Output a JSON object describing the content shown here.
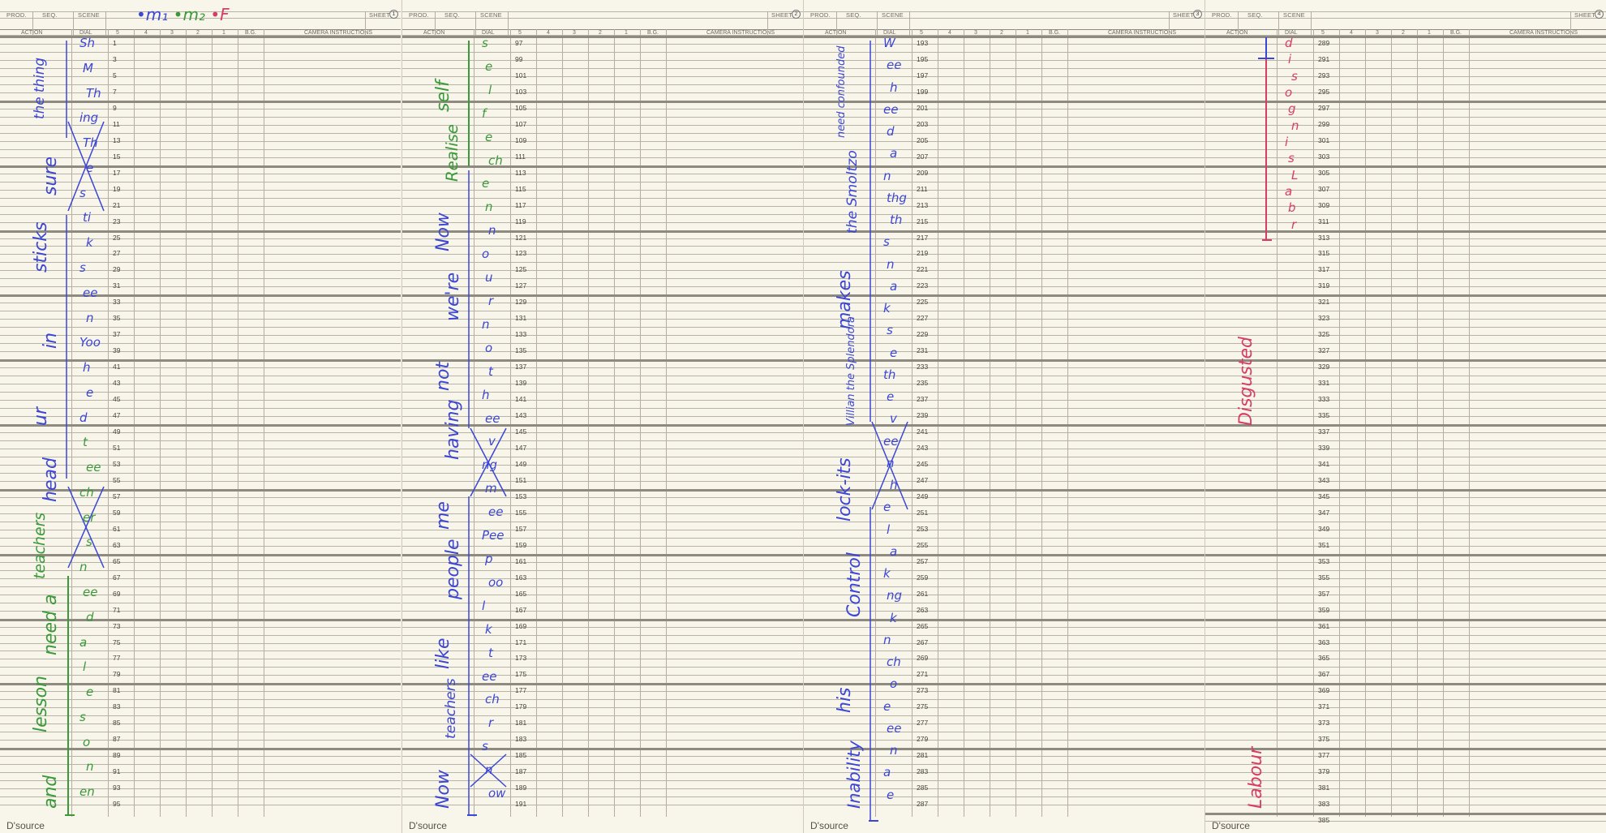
{
  "header": {
    "prod": "PROD.",
    "seq": "SEQ.",
    "scene": "SCENE",
    "sheet": "SHEET",
    "action": "ACTION",
    "dial": "DIAL",
    "c5": "5",
    "c4": "4",
    "c3": "3",
    "c2": "2",
    "c1": "1",
    "bg": "B.G.",
    "camera": "CAMERA INSTRUCTIONS"
  },
  "legend": {
    "m1": "•m₁",
    "m2": "•m₂",
    "f": "•F"
  },
  "footer": "D'source",
  "sheets": [
    {
      "number": "1",
      "frames": [
        "1",
        "3",
        "5",
        "7",
        "9",
        "11",
        "13",
        "15",
        "17",
        "19",
        "21",
        "23",
        "25",
        "27",
        "29",
        "31",
        "33",
        "35",
        "37",
        "39",
        "41",
        "43",
        "45",
        "47",
        "49",
        "51",
        "53",
        "55",
        "57",
        "59",
        "61",
        "63",
        "65",
        "67",
        "69",
        "71",
        "73",
        "75",
        "77",
        "79",
        "81",
        "83",
        "85",
        "87",
        "89",
        "91",
        "93",
        "95"
      ],
      "action": [
        {
          "text": "the thing",
          "ink": "blue"
        },
        {
          "text": "sure",
          "ink": "blue"
        },
        {
          "text": "sticks",
          "ink": "blue"
        },
        {
          "text": "in",
          "ink": "blue"
        },
        {
          "text": "ur",
          "ink": "blue"
        },
        {
          "text": "head",
          "ink": "blue"
        },
        {
          "text": "teachers",
          "ink": "green"
        },
        {
          "text": "need a",
          "ink": "green"
        },
        {
          "text": "lesson",
          "ink": "green"
        },
        {
          "text": "and",
          "ink": "green"
        }
      ],
      "dial": [
        {
          "text": "Sh",
          "ink": "blue"
        },
        {
          "text": "M",
          "ink": "blue"
        },
        {
          "text": "Th",
          "ink": "blue"
        },
        {
          "text": "ing",
          "ink": "blue"
        },
        {
          "text": "Th",
          "ink": "blue"
        },
        {
          "text": "e",
          "ink": "blue"
        },
        {
          "text": "s",
          "ink": "blue"
        },
        {
          "text": "ti",
          "ink": "blue"
        },
        {
          "text": "k",
          "ink": "blue"
        },
        {
          "text": "s",
          "ink": "blue"
        },
        {
          "text": "ee",
          "ink": "blue"
        },
        {
          "text": "n",
          "ink": "blue"
        },
        {
          "text": "Yoo",
          "ink": "blue"
        },
        {
          "text": "h",
          "ink": "blue"
        },
        {
          "text": "e",
          "ink": "blue"
        },
        {
          "text": "d",
          "ink": "blue"
        },
        {
          "text": "t",
          "ink": "green"
        },
        {
          "text": "ee",
          "ink": "green"
        },
        {
          "text": "ch",
          "ink": "green"
        },
        {
          "text": "er",
          "ink": "green"
        },
        {
          "text": "s",
          "ink": "green"
        },
        {
          "text": "n",
          "ink": "green"
        },
        {
          "text": "ee",
          "ink": "green"
        },
        {
          "text": "d",
          "ink": "green"
        },
        {
          "text": "a",
          "ink": "green"
        },
        {
          "text": "l",
          "ink": "green"
        },
        {
          "text": "e",
          "ink": "green"
        },
        {
          "text": "s",
          "ink": "green"
        },
        {
          "text": "o",
          "ink": "green"
        },
        {
          "text": "n",
          "ink": "green"
        },
        {
          "text": "en",
          "ink": "green"
        }
      ]
    },
    {
      "number": "2",
      "frames": [
        "97",
        "99",
        "101",
        "103",
        "105",
        "107",
        "109",
        "111",
        "113",
        "115",
        "117",
        "119",
        "121",
        "123",
        "125",
        "127",
        "129",
        "131",
        "133",
        "135",
        "137",
        "139",
        "141",
        "143",
        "145",
        "147",
        "149",
        "151",
        "153",
        "155",
        "157",
        "159",
        "161",
        "163",
        "165",
        "167",
        "169",
        "171",
        "173",
        "175",
        "177",
        "179",
        "181",
        "183",
        "185",
        "187",
        "189",
        "191"
      ],
      "action": [
        {
          "text": "self",
          "ink": "green"
        },
        {
          "text": "Realise",
          "ink": "green"
        },
        {
          "text": "Now",
          "ink": "blue"
        },
        {
          "text": "we're",
          "ink": "blue"
        },
        {
          "text": "not",
          "ink": "blue"
        },
        {
          "text": "having",
          "ink": "blue"
        },
        {
          "text": "me",
          "ink": "blue"
        },
        {
          "text": "people",
          "ink": "blue"
        },
        {
          "text": "like",
          "ink": "blue"
        },
        {
          "text": "teachers",
          "ink": "blue"
        },
        {
          "text": "Now",
          "ink": "blue"
        }
      ],
      "dial": [
        {
          "text": "s",
          "ink": "green"
        },
        {
          "text": "e",
          "ink": "green"
        },
        {
          "text": "l",
          "ink": "green"
        },
        {
          "text": "f",
          "ink": "green"
        },
        {
          "text": "e",
          "ink": "green"
        },
        {
          "text": "ch",
          "ink": "green"
        },
        {
          "text": "e",
          "ink": "green"
        },
        {
          "text": "n",
          "ink": "green"
        },
        {
          "text": "n",
          "ink": "blue"
        },
        {
          "text": "o",
          "ink": "blue"
        },
        {
          "text": "u",
          "ink": "blue"
        },
        {
          "text": "r",
          "ink": "blue"
        },
        {
          "text": "n",
          "ink": "blue"
        },
        {
          "text": "o",
          "ink": "blue"
        },
        {
          "text": "t",
          "ink": "blue"
        },
        {
          "text": "h",
          "ink": "blue"
        },
        {
          "text": "ee",
          "ink": "blue"
        },
        {
          "text": "v",
          "ink": "blue"
        },
        {
          "text": "ng",
          "ink": "blue"
        },
        {
          "text": "m",
          "ink": "blue"
        },
        {
          "text": "ee",
          "ink": "blue"
        },
        {
          "text": "Pee",
          "ink": "blue"
        },
        {
          "text": "p",
          "ink": "blue"
        },
        {
          "text": "oo",
          "ink": "blue"
        },
        {
          "text": "l",
          "ink": "blue"
        },
        {
          "text": "k",
          "ink": "blue"
        },
        {
          "text": "t",
          "ink": "blue"
        },
        {
          "text": "ee",
          "ink": "blue"
        },
        {
          "text": "ch",
          "ink": "blue"
        },
        {
          "text": "r",
          "ink": "blue"
        },
        {
          "text": "s",
          "ink": "blue"
        },
        {
          "text": "n",
          "ink": "blue"
        },
        {
          "text": "ow",
          "ink": "blue"
        }
      ]
    },
    {
      "number": "3",
      "frames": [
        "193",
        "195",
        "197",
        "199",
        "201",
        "203",
        "205",
        "207",
        "209",
        "211",
        "213",
        "215",
        "217",
        "219",
        "221",
        "223",
        "225",
        "227",
        "229",
        "231",
        "233",
        "235",
        "237",
        "239",
        "241",
        "243",
        "245",
        "247",
        "249",
        "251",
        "253",
        "255",
        "257",
        "259",
        "261",
        "263",
        "265",
        "267",
        "269",
        "271",
        "273",
        "275",
        "277",
        "279",
        "281",
        "283",
        "285",
        "287"
      ],
      "action": [
        {
          "text": "need confounded",
          "ink": "blue"
        },
        {
          "text": "the Smoltzo",
          "ink": "blue"
        },
        {
          "text": "makes",
          "ink": "blue"
        },
        {
          "text": "Villian the Splendora",
          "ink": "blue"
        },
        {
          "text": "lock-its",
          "ink": "blue"
        },
        {
          "text": "Control",
          "ink": "blue"
        },
        {
          "text": "his",
          "ink": "blue"
        },
        {
          "text": "Inability",
          "ink": "blue"
        }
      ],
      "dial": [
        {
          "text": "W",
          "ink": "blue"
        },
        {
          "text": "ee",
          "ink": "blue"
        },
        {
          "text": "h",
          "ink": "blue"
        },
        {
          "text": "ee",
          "ink": "blue"
        },
        {
          "text": "d",
          "ink": "blue"
        },
        {
          "text": "a",
          "ink": "blue"
        },
        {
          "text": "n",
          "ink": "blue"
        },
        {
          "text": "thg",
          "ink": "blue"
        },
        {
          "text": "th",
          "ink": "blue"
        },
        {
          "text": "s",
          "ink": "blue"
        },
        {
          "text": "n",
          "ink": "blue"
        },
        {
          "text": "a",
          "ink": "blue"
        },
        {
          "text": "k",
          "ink": "blue"
        },
        {
          "text": "s",
          "ink": "blue"
        },
        {
          "text": "e",
          "ink": "blue"
        },
        {
          "text": "th",
          "ink": "blue"
        },
        {
          "text": "e",
          "ink": "blue"
        },
        {
          "text": "v",
          "ink": "blue"
        },
        {
          "text": "ee",
          "ink": "blue"
        },
        {
          "text": "n",
          "ink": "blue"
        },
        {
          "text": "h",
          "ink": "blue"
        },
        {
          "text": "e",
          "ink": "blue"
        },
        {
          "text": "l",
          "ink": "blue"
        },
        {
          "text": "a",
          "ink": "blue"
        },
        {
          "text": "k",
          "ink": "blue"
        },
        {
          "text": "ng",
          "ink": "blue"
        },
        {
          "text": "k",
          "ink": "blue"
        },
        {
          "text": "n",
          "ink": "blue"
        },
        {
          "text": "ch",
          "ink": "blue"
        },
        {
          "text": "o",
          "ink": "blue"
        },
        {
          "text": "e",
          "ink": "blue"
        },
        {
          "text": "ee",
          "ink": "blue"
        },
        {
          "text": "n",
          "ink": "blue"
        },
        {
          "text": "a",
          "ink": "blue"
        },
        {
          "text": "e",
          "ink": "blue"
        }
      ]
    },
    {
      "number": "4",
      "frames": [
        "289",
        "291",
        "293",
        "295",
        "297",
        "299",
        "301",
        "303",
        "305",
        "307",
        "309",
        "311",
        "313",
        "315",
        "317",
        "319",
        "321",
        "323",
        "325",
        "327",
        "329",
        "331",
        "333",
        "335",
        "337",
        "339",
        "341",
        "343",
        "345",
        "347",
        "349",
        "351",
        "353",
        "355",
        "357",
        "359",
        "361",
        "363",
        "365",
        "367",
        "369",
        "371",
        "373",
        "375",
        "377",
        "379",
        "381",
        "383",
        "385"
      ],
      "action": [
        {
          "text": "Disgusted",
          "ink": "red"
        },
        {
          "text": "Labour",
          "ink": "red"
        }
      ],
      "dial": [
        {
          "text": "d",
          "ink": "red"
        },
        {
          "text": "i",
          "ink": "red"
        },
        {
          "text": "s",
          "ink": "red"
        },
        {
          "text": "o",
          "ink": "red"
        },
        {
          "text": "g",
          "ink": "red"
        },
        {
          "text": "n",
          "ink": "red"
        },
        {
          "text": "i",
          "ink": "red"
        },
        {
          "text": "s",
          "ink": "red"
        },
        {
          "text": "L",
          "ink": "red"
        },
        {
          "text": "a",
          "ink": "red"
        },
        {
          "text": "b",
          "ink": "red"
        },
        {
          "text": "r",
          "ink": "red"
        }
      ]
    }
  ]
}
